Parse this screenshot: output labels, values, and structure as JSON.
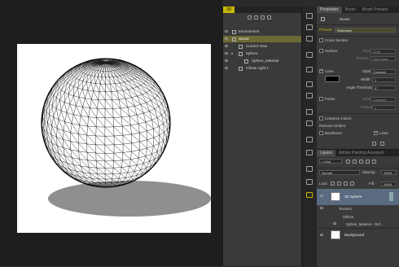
{
  "panel3d": {
    "tab_label": "3D",
    "rows": [
      {
        "label": "Environment",
        "selected": false
      },
      {
        "label": "Scene",
        "selected": true
      },
      {
        "label": "Current View",
        "selected": false
      },
      {
        "label": "Sphere",
        "selected": false
      },
      {
        "label": "Sphere_Material",
        "selected": false
      },
      {
        "label": "Infinite Light 1",
        "selected": false
      }
    ]
  },
  "properties": {
    "tabs": [
      "Properties",
      "Brush",
      "Brush Presets"
    ],
    "header_title": "Scene",
    "presets_label": "Presets:",
    "presets_value": "Wireframe",
    "cross_section_label": "Cross Section",
    "surface_label": "Surface",
    "surface_style_label": "Style:",
    "surface_style_value": "Solid",
    "surface_texture_label": "Texture:",
    "surface_texture_value": "Not Availa...",
    "lines_label": "Lines",
    "lines_style_label": "Style:",
    "lines_style_value": "Constant",
    "lines_width_label": "Width:",
    "lines_width_value": "1",
    "angle_threshold_label": "Angle Threshold:",
    "angle_threshold_value": "0°",
    "points_label": "Points",
    "points_style_label": "Style:",
    "points_style_value": "Constant",
    "points_radius_label": "Radius:",
    "points_radius_value": "1",
    "linearize_label": "Linearize Colors",
    "remove_hidden_label": "Remove Hidden:",
    "backfaces_label": "Backfaces",
    "lines_check_label": "Lines"
  },
  "layers": {
    "tabs": [
      "Layers",
      "Adobe Painting Assistant"
    ],
    "kind_label": "Kind",
    "blend_mode": "Normal",
    "opacity_label": "Opacity:",
    "opacity_value": "100%",
    "lock_label": "Lock:",
    "fill_label": "Fill:",
    "fill_value": "100%",
    "items": {
      "sphere_layer": "3D Sphere",
      "textures": "Textures",
      "diffuse": "Diffuse",
      "material": "Sphere_Material – Def...",
      "background": "Background"
    }
  },
  "colors": {
    "selection": "#6b6a34",
    "accent_yellow": "#c9b800",
    "panel_bg": "#3a3a3a",
    "canvas_bg": "#1e1e1e"
  }
}
